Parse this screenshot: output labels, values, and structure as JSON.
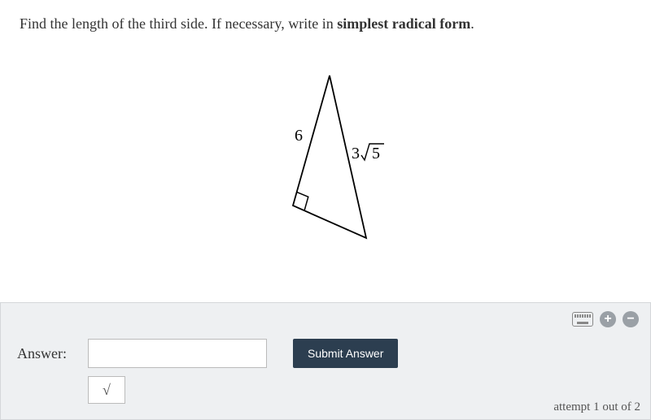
{
  "question": {
    "prefix": "Find the length of the third side. If necessary, write in ",
    "bold": "simplest radical form",
    "suffix": "."
  },
  "triangle": {
    "leg_label": "6",
    "hypotenuse_coefficient": "3",
    "hypotenuse_radicand": "5"
  },
  "answer_panel": {
    "label": "Answer:",
    "input_value": "",
    "submit_label": "Submit Answer",
    "sqrt_symbol": "√",
    "attempt_text": "attempt 1 out of 2"
  },
  "icons": {
    "plus": "+",
    "minus": "−"
  }
}
